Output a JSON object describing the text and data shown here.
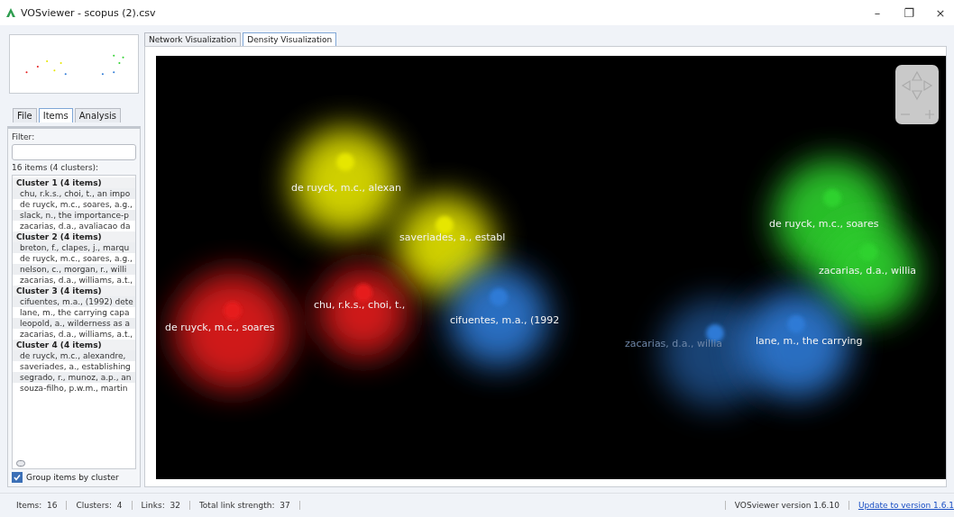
{
  "window": {
    "title": "VOSviewer - scopus (2).csv",
    "controls": [
      "–",
      "❐",
      "×"
    ]
  },
  "side_tabs": [
    {
      "label": "File",
      "selected": false
    },
    {
      "label": "Items",
      "selected": true
    },
    {
      "label": "Analysis",
      "selected": false
    }
  ],
  "filter": {
    "label": "Filter:"
  },
  "items_summary": "16 items (4 clusters):",
  "clusters": [
    {
      "label": "Cluster 1 (4 items)",
      "children": [
        {
          "label": "chu, r.k.s., choi, t., an impo"
        },
        {
          "label": "de ruyck, m.c., soares, a.g.,"
        },
        {
          "label": "slack, n., the importance-p"
        },
        {
          "label": "zacarias, d.a., avaliacao da"
        }
      ]
    },
    {
      "label": "Cluster 2 (4 items)",
      "children": [
        {
          "label": "breton, f., clapes, j., marqu"
        },
        {
          "label": "de ruyck, m.c., soares, a.g.,"
        },
        {
          "label": "nelson, c., morgan, r., willi"
        },
        {
          "label": "zacarias, d.a., williams, a.t.,"
        }
      ]
    },
    {
      "label": "Cluster 3 (4 items)",
      "children": [
        {
          "label": "cifuentes, m.a., (1992) dete"
        },
        {
          "label": "lane, m., the carrying capa"
        },
        {
          "label": "leopold, a., wilderness as a"
        },
        {
          "label": "zacarias, d.a., williams, a.t.,"
        }
      ]
    },
    {
      "label": "Cluster 4 (4 items)",
      "children": [
        {
          "label": "de ruyck, m.c., alexandre,"
        },
        {
          "label": "saveriades, a., establishing"
        },
        {
          "label": "segrado, r., munoz, a.p., an"
        },
        {
          "label": "souza-filho, p.w.m., martin"
        }
      ]
    }
  ],
  "group_by_cluster": {
    "label": "Group items by cluster",
    "checked": true
  },
  "view_tabs": [
    {
      "label": "Network Visualization",
      "selected": false
    },
    {
      "label": "Density Visualization",
      "selected": true
    }
  ],
  "density_labels": [
    {
      "label": "de ruyck, m.c., alexan",
      "color": "#e6e600",
      "faded": false
    },
    {
      "label": "saveriades, a., establ",
      "color": "#e6e600",
      "faded": false
    },
    {
      "label": "de ruyck, m.c., soares",
      "color": "#e61e1e",
      "faded": false
    },
    {
      "label": "chu, r.k.s., choi, t.,",
      "color": "#e61e1e",
      "faded": false
    },
    {
      "label": "cifuentes, m.a., (1992",
      "color": "#2d7ad6",
      "faded": false
    },
    {
      "label": "de ruyck, m.c., soares",
      "color": "#2fd22f",
      "faded": false
    },
    {
      "label": "zacarias, d.a., willia",
      "color": "#2fd22f",
      "faded": false
    },
    {
      "label": "zacarias, d.a., willia",
      "color": "#2d7ad6",
      "faded": true
    },
    {
      "label": "lane, m., the carrying",
      "color": "#2d7ad6",
      "faded": false
    }
  ],
  "status_bar": [
    {
      "label": "Items:",
      "value": "16"
    },
    {
      "label": "Clusters:",
      "value": "4"
    },
    {
      "label": "Links:",
      "value": "32"
    },
    {
      "label": "Total link strength:",
      "value": "37"
    }
  ],
  "version": "VOSviewer version 1.6.10",
  "update_link": "Update to version 1.6.1"
}
